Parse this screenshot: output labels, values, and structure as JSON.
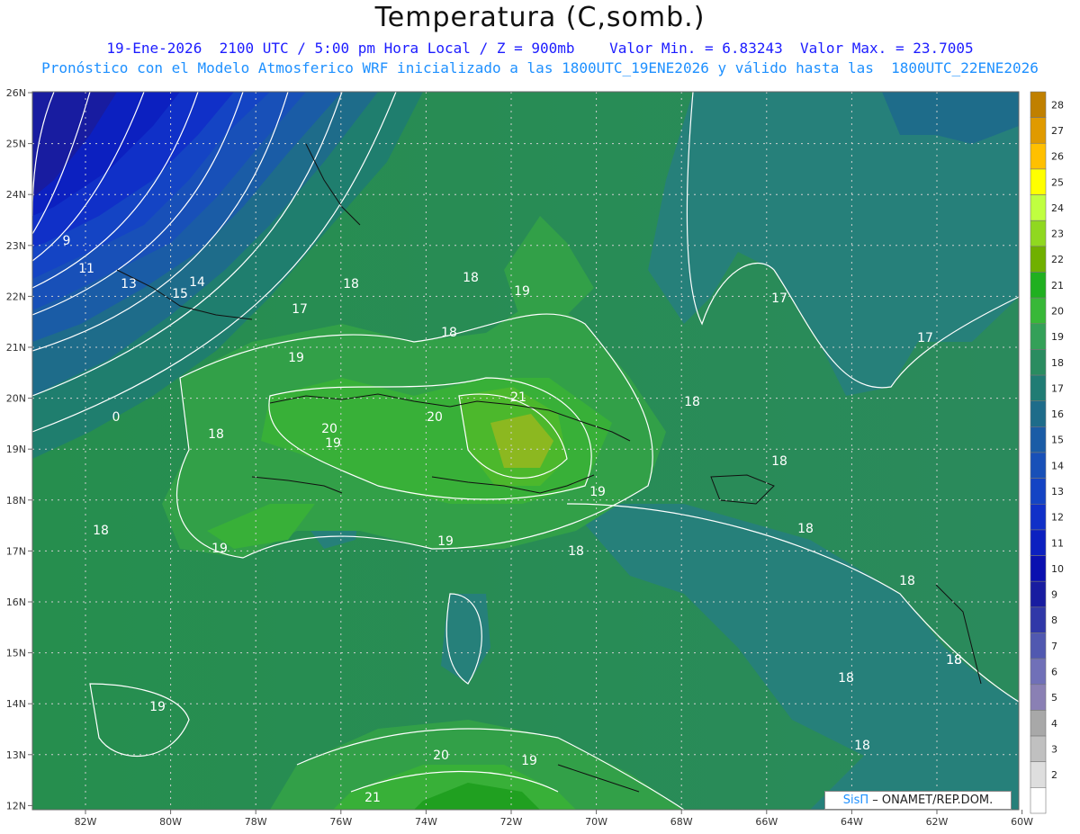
{
  "header": {
    "title": "Temperatura (C,somb.)",
    "subtitle_line1": "19-Ene-2026  2100 UTC / 5:00 pm Hora Local / Z = 900mb    Valor Min. = 6.83243  Valor Max. = 23.7005",
    "subtitle_line2": "Pronóstico con el Modelo Atmosferico WRF inicializado a las 1800UTC_19ENE2026 y válido hasta las  1800UTC_22ENE2026"
  },
  "map": {
    "lon_ticks": [
      "82W",
      "80W",
      "78W",
      "76W",
      "74W",
      "72W",
      "70W",
      "68W",
      "66W",
      "64W",
      "62W",
      "60W"
    ],
    "lat_ticks": [
      "26N",
      "25N",
      "24N",
      "23N",
      "22N",
      "21N",
      "20N",
      "19N",
      "18N",
      "17N",
      "16N",
      "15N",
      "14N",
      "13N",
      "12N"
    ],
    "contour_labels": [
      {
        "text": "9"
      },
      {
        "text": "11"
      },
      {
        "text": "13"
      },
      {
        "text": "14"
      },
      {
        "text": "15"
      },
      {
        "text": "17"
      },
      {
        "text": "18"
      },
      {
        "text": "18"
      },
      {
        "text": "19"
      },
      {
        "text": "18"
      },
      {
        "text": "17"
      },
      {
        "text": "17"
      },
      {
        "text": "19"
      },
      {
        "text": "21"
      },
      {
        "text": "20"
      },
      {
        "text": "20"
      },
      {
        "text": "19"
      },
      {
        "text": "18"
      },
      {
        "text": "18"
      },
      {
        "text": "18"
      },
      {
        "text": "0"
      },
      {
        "text": "18"
      },
      {
        "text": "19"
      },
      {
        "text": "19"
      },
      {
        "text": "19"
      },
      {
        "text": "18"
      },
      {
        "text": "18"
      },
      {
        "text": "18"
      },
      {
        "text": "18"
      },
      {
        "text": "18"
      },
      {
        "text": "19"
      },
      {
        "text": "20"
      },
      {
        "text": "19"
      },
      {
        "text": "21"
      },
      {
        "text": "18"
      },
      {
        "text": "18"
      }
    ]
  },
  "colorbar": {
    "labels": [
      "28",
      "27",
      "26",
      "25",
      "24",
      "23",
      "22",
      "21",
      "20",
      "19",
      "18",
      "17",
      "16",
      "15",
      "14",
      "13",
      "12",
      "11",
      "10",
      "9",
      "8",
      "7",
      "6",
      "5",
      "4",
      "3",
      "2"
    ],
    "colors": [
      "#c08000",
      "#e09a00",
      "#ffc000",
      "#ffff00",
      "#c0ff40",
      "#90d820",
      "#70b000",
      "#20b020",
      "#38b838",
      "#34a058",
      "#2a8c60",
      "#207c74",
      "#1e6c8a",
      "#1a5ca6",
      "#1850b8",
      "#1444c4",
      "#1030c8",
      "#0c20c0",
      "#0a10b0",
      "#181ca0",
      "#3038a8",
      "#5058b0",
      "#7070b8",
      "#8a80b4",
      "#a8a8a8",
      "#c0c0c0",
      "#dedede",
      "#ffffff"
    ]
  },
  "credit": {
    "brand": "SisΠ",
    "rest": " – ONAMET/REP.DOM."
  }
}
